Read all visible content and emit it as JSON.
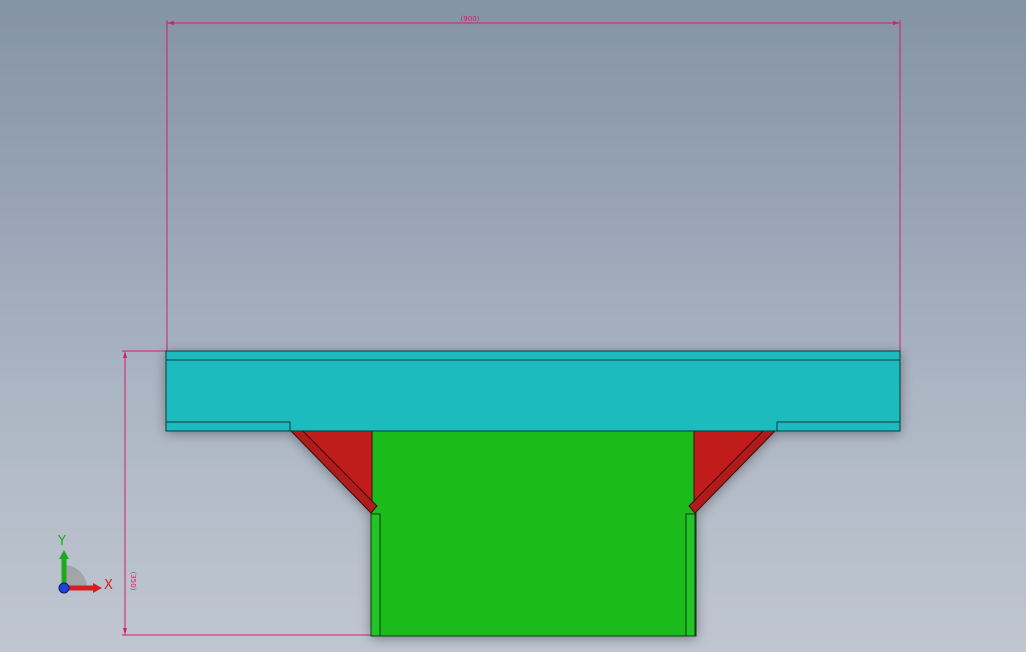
{
  "viewport": {
    "background_top": "#8593a6",
    "background_bottom": "#bfc6d0"
  },
  "dimensions": {
    "horizontal_label": "(900)",
    "vertical_label": "(350)",
    "color": "#d0206a"
  },
  "model": {
    "flange_color": "#1abbbd",
    "body_color": "#1bbb1f",
    "gusset_color": "#c01c1c"
  },
  "triad": {
    "x_label": "X",
    "y_label": "Y",
    "x_color": "#d42020",
    "y_color": "#1aaa1a",
    "z_color": "#2040e0"
  }
}
